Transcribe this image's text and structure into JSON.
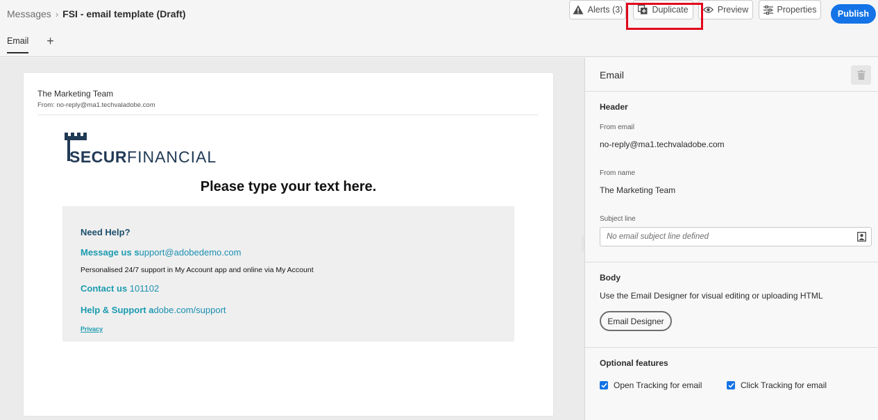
{
  "breadcrumb": {
    "parent": "Messages",
    "separator": "›",
    "current": "FSI - email template (Draft)"
  },
  "toolbar": {
    "alerts_label": "Alerts (3)",
    "duplicate_label": "Duplicate",
    "preview_label": "Preview",
    "properties_label": "Properties",
    "publish_label": "Publish",
    "accent_color": "#1473e6",
    "highlight_color": "#e1051c"
  },
  "tabs": {
    "email": "Email",
    "add": "+"
  },
  "email_preview": {
    "sender_name": "The Marketing Team",
    "sender_from": "From: no-reply@ma1.techvaladobe.com",
    "logo_bold": "SECUR",
    "logo_light": "FINANCIAL",
    "headline": "Please type your text here.",
    "help": {
      "title": "Need Help?",
      "message_label": "Message us s",
      "message_value": "upport@adobedemo.com",
      "note": "Personalised 24/7 support in My Account app and online via My Account",
      "contact_label": "Contact us",
      "contact_value": " 101102",
      "support_label": "Help & Support a",
      "support_value": "dobe.com/support",
      "privacy": "Privacy"
    }
  },
  "panel": {
    "title": "Email",
    "header_section": "Header",
    "from_email_label": "From email",
    "from_email_value": "no-reply@ma1.techvaladobe.com",
    "from_name_label": "From name",
    "from_name_value": "The Marketing Team",
    "subject_label": "Subject line",
    "subject_placeholder": "No email subject line defined",
    "body_section": "Body",
    "body_description": "Use the Email Designer for visual editing or uploading HTML",
    "email_designer_button": "Email Designer",
    "optional_section": "Optional features",
    "open_tracking_label": "Open Tracking for email",
    "open_tracking_checked": true,
    "click_tracking_label": "Click Tracking for email",
    "click_tracking_checked": true
  },
  "icons": {
    "alerts": "alert-triangle-icon",
    "duplicate": "duplicate-icon",
    "preview": "eye-icon",
    "properties": "sliders-icon",
    "delete": "trash-icon",
    "personalization": "personalization-icon",
    "checkbox": "checkmark-icon"
  }
}
